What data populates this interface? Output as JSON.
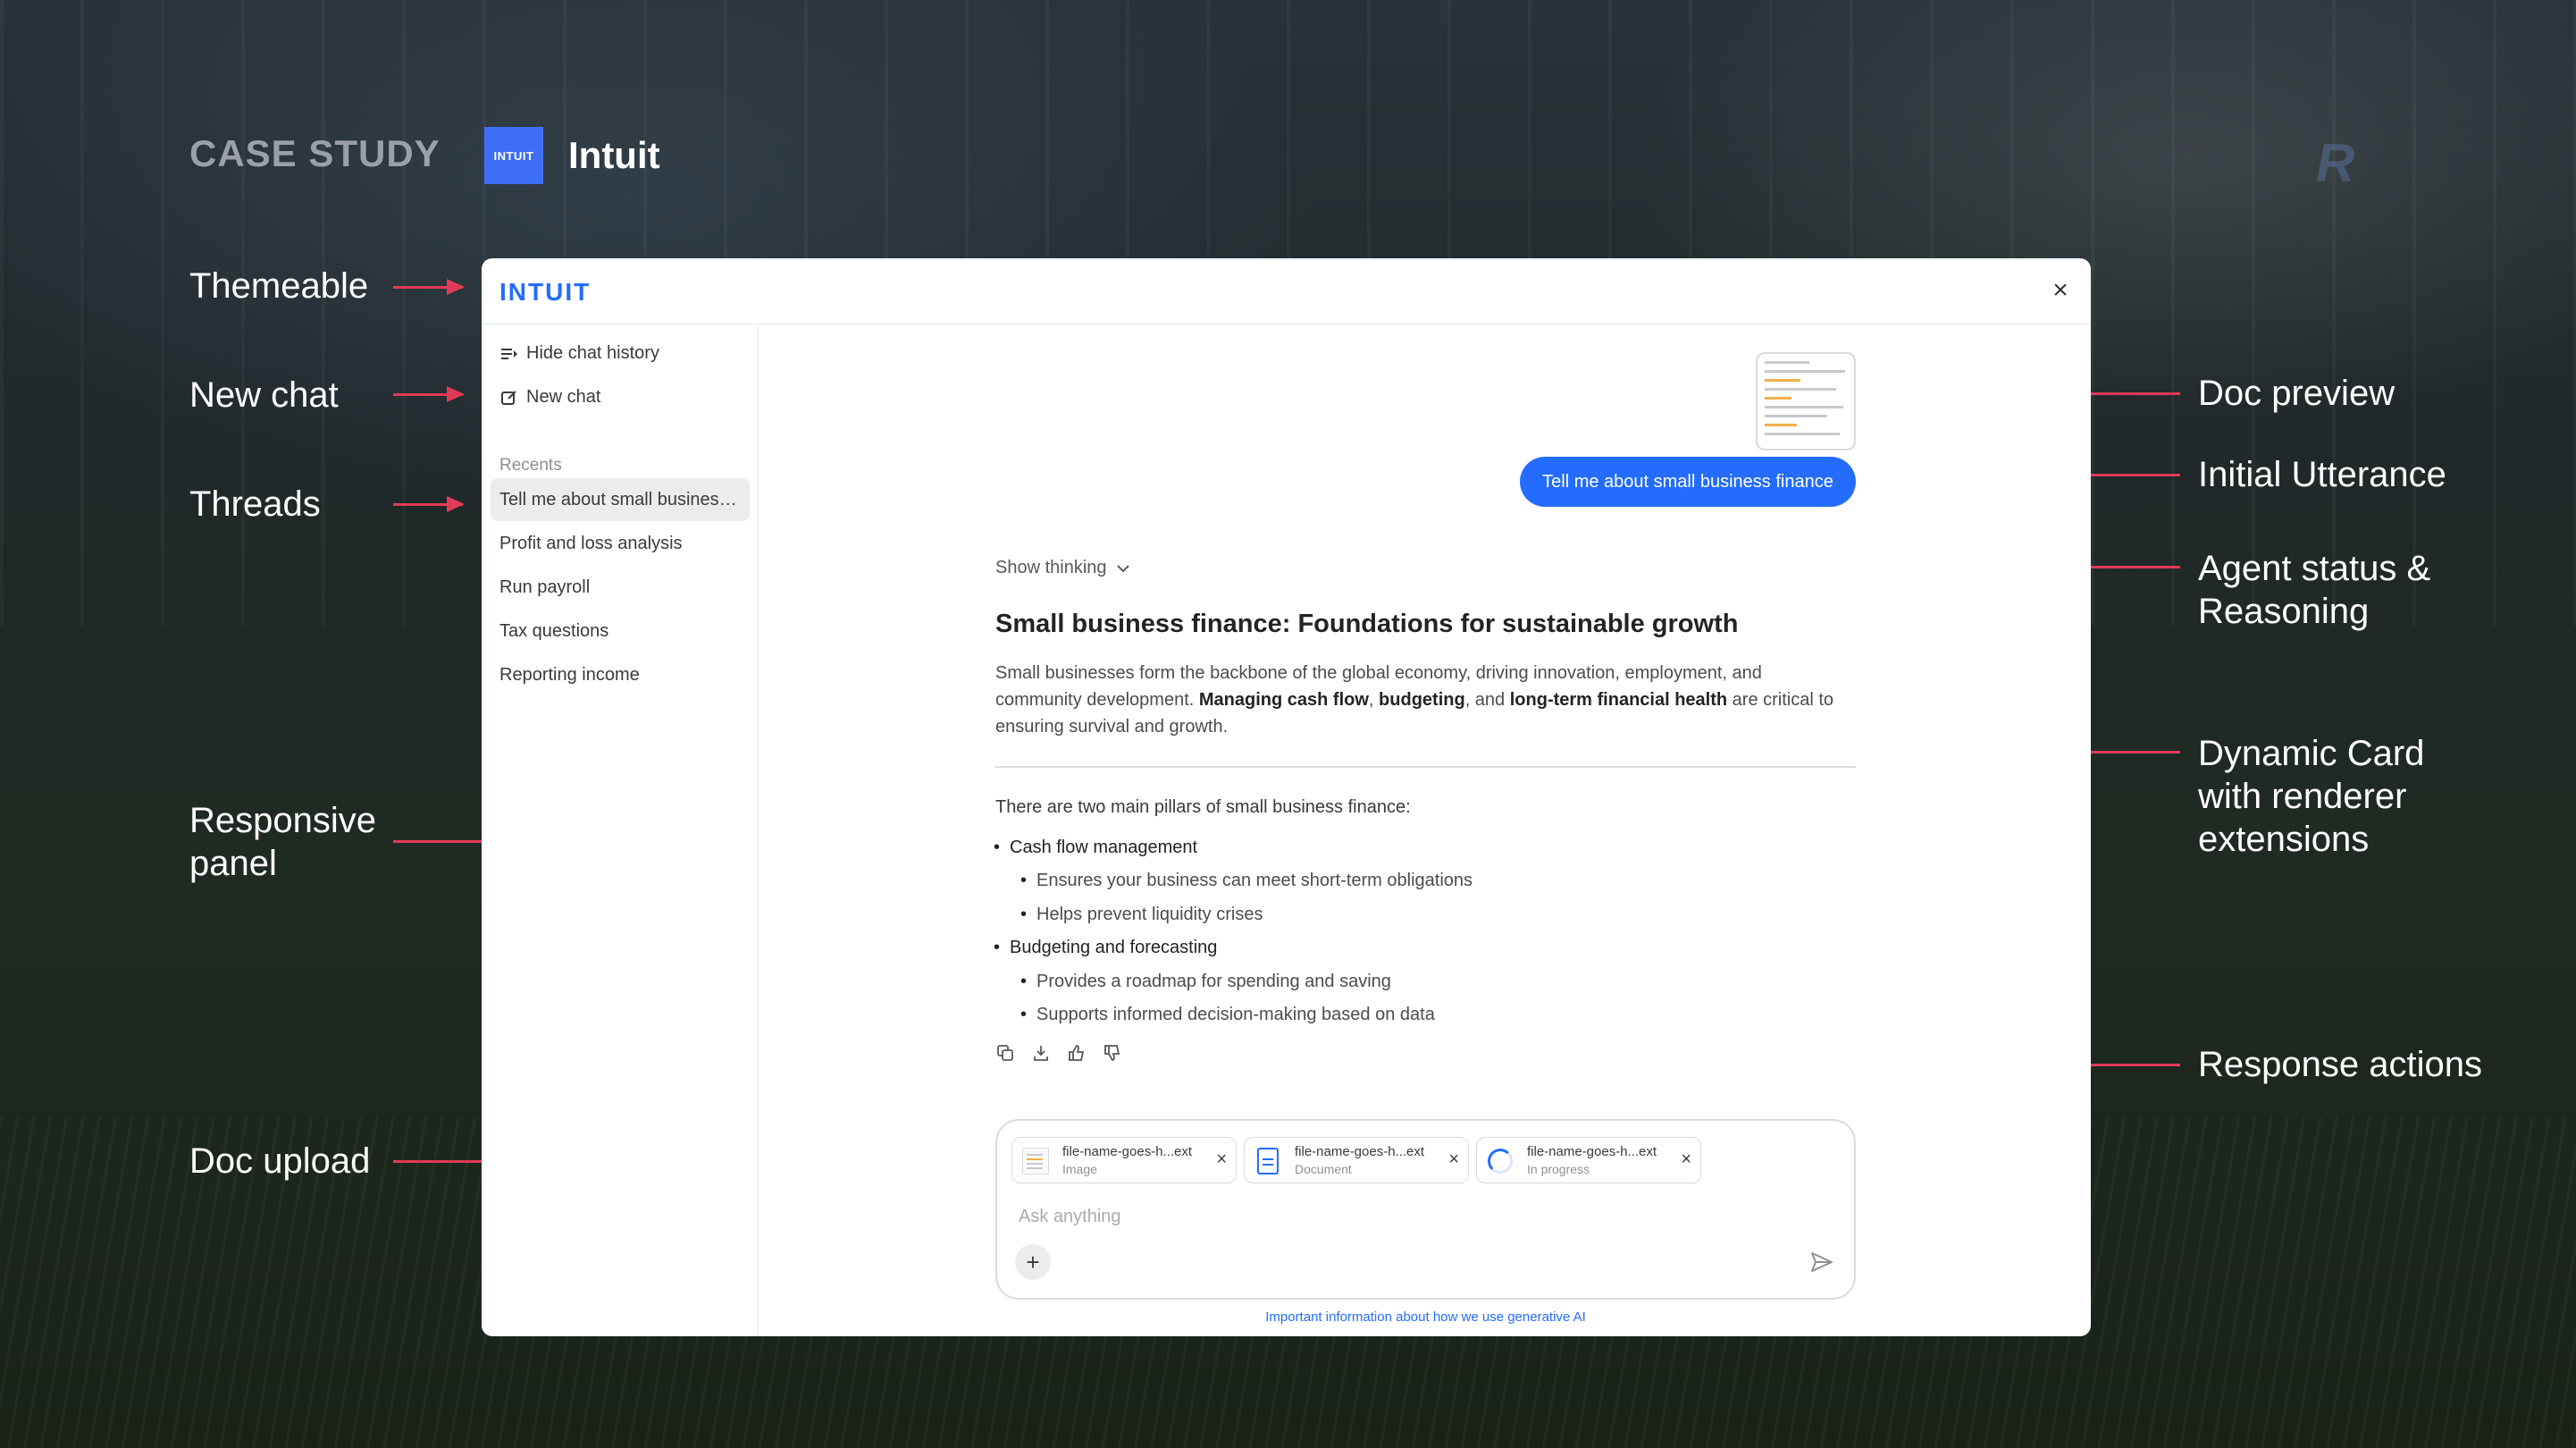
{
  "header": {
    "case_study": "CASE STUDY",
    "brand_tile": "INTUIT",
    "brand_name": "Intuit"
  },
  "annotations": {
    "themeable": "Themeable",
    "new_chat": "New chat",
    "threads": "Threads",
    "responsive_panel_1": "Responsive",
    "responsive_panel_2": "panel",
    "doc_upload": "Doc upload",
    "doc_preview": "Doc preview",
    "initial_utterance": "Initial Utterance",
    "agent_status_1": "Agent status &",
    "agent_status_2": "Reasoning",
    "dynamic_card_1": "Dynamic Card",
    "dynamic_card_2": "with renderer",
    "dynamic_card_3": "extensions",
    "response_actions": "Response actions"
  },
  "window": {
    "logo": "INTUIT",
    "close_icon": "×",
    "sidebar": {
      "hide_history": "Hide chat history",
      "new_chat": "New chat",
      "recents_label": "Recents",
      "threads": [
        "Tell me about small business finance",
        "Profit and loss analysis",
        "Run payroll",
        "Tax questions",
        "Reporting income"
      ]
    },
    "chat": {
      "utterance": "Tell me about small business finance",
      "show_thinking": "Show thinking",
      "title": "Small business finance: Foundations for sustainable growth",
      "para_1": "Small businesses form the backbone of the global economy, driving innovation, employment, and community development.",
      "para_bold_1": "Managing cash flow",
      "para_sep_1": ",",
      "para_bold_2": "budgeting",
      "para_sep_2": ", and",
      "para_bold_3": "long-term financial health",
      "para_2": "are critical to ensuring survival and growth.",
      "pillars_intro": "There are two main pillars of small business finance:",
      "pillar_1": "Cash flow management",
      "pillar_1_a": "Ensures your business can meet short-term obligations",
      "pillar_1_b": "Helps prevent liquidity crises",
      "pillar_2": "Budgeting and forecasting",
      "pillar_2_a": "Provides a roadmap for spending and saving",
      "pillar_2_b": "Supports informed decision-making based on data"
    },
    "composer": {
      "attachments": [
        {
          "name": "file-name-goes-h...ext",
          "type": "Image"
        },
        {
          "name": "file-name-goes-h...ext",
          "type": "Document"
        },
        {
          "name": "file-name-goes-h...ext",
          "type": "In progress"
        }
      ],
      "placeholder": "Ask anything",
      "plus_label": "+",
      "disclaimer": "Important information about how we use generative AI"
    }
  },
  "colors": {
    "accent": "#236cff",
    "arrow": "#e23a57",
    "tile": "#3d6ef5"
  }
}
